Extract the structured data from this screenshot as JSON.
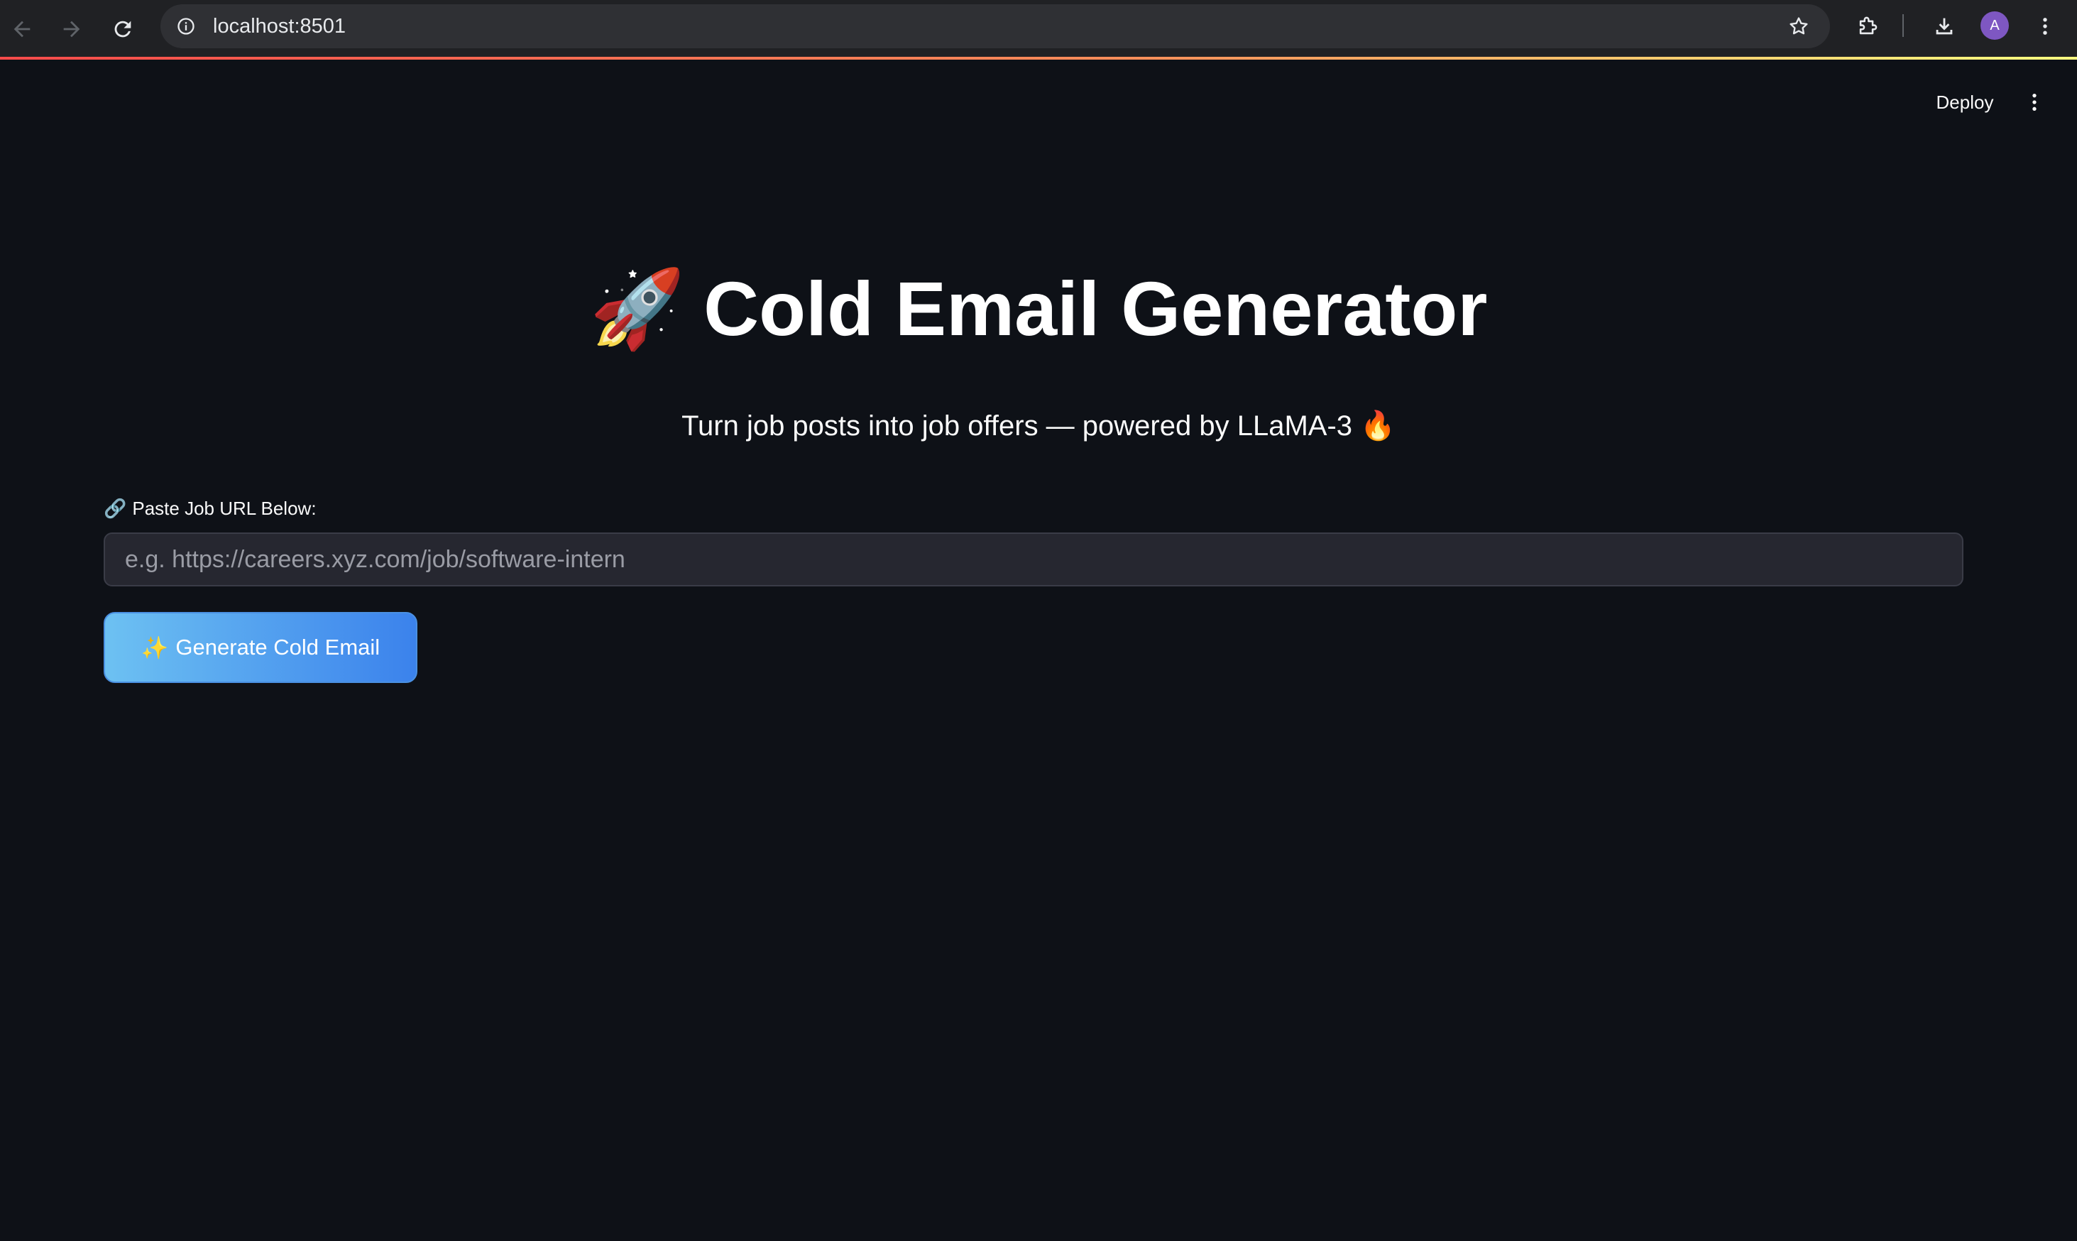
{
  "browser": {
    "url": "localhost:8501",
    "avatar_initial": "A",
    "icons": {
      "back": "arrow-left-icon",
      "forward": "arrow-right-icon",
      "reload": "reload-icon",
      "site_info": "info-icon",
      "bookmark": "star-icon",
      "extensions": "puzzle-icon",
      "downloads": "download-icon",
      "menu": "kebab-menu-icon"
    }
  },
  "app_toolbar": {
    "deploy_label": "Deploy",
    "menu_icon": "kebab-menu-icon"
  },
  "main": {
    "title_emoji": "🚀",
    "title": "Cold Email Generator",
    "subtitle": "Turn job posts into job offers — powered by LLaMA-3 🔥",
    "url_field": {
      "label_emoji": "🔗",
      "label": "Paste Job URL Below:",
      "placeholder": "e.g. https://careers.xyz.com/job/software-intern",
      "value": ""
    },
    "generate_button": {
      "emoji": "✨",
      "label": "Generate Cold Email"
    }
  },
  "colors": {
    "app_background": "#0e1117",
    "input_background": "#262730",
    "button_gradient_start": "#6dc1f2",
    "button_gradient_end": "#3b82ec"
  }
}
